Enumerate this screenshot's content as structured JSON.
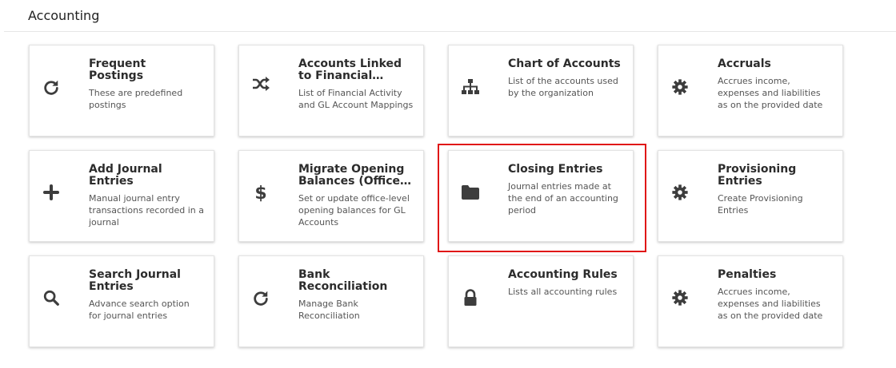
{
  "page": {
    "title": "Accounting"
  },
  "colors": {
    "icon": "#3d3d3d",
    "highlight": "#e01717"
  },
  "cards": [
    {
      "title": "Frequent Postings",
      "description": "These are predefined postings",
      "icon": "refresh-icon"
    },
    {
      "title": "Accounts Linked to Financial Activities",
      "description": "List of Financial Activity and GL Account Mappings",
      "icon": "shuffle-icon"
    },
    {
      "title": "Chart of Accounts",
      "description": "List of the accounts used by the organization",
      "icon": "sitemap-icon"
    },
    {
      "title": "Accruals",
      "description": "Accrues income, expenses and liabilities as on the provided date",
      "icon": "gear-icon"
    },
    {
      "title": "Add Journal Entries",
      "description": "Manual journal entry transactions recorded in a journal",
      "icon": "plus-icon"
    },
    {
      "title": "Migrate Opening Balances (Office-wise)",
      "description": "Set or update office-level opening balances for GL Accounts",
      "icon": "dollar-icon"
    },
    {
      "title": "Closing Entries",
      "description": "Journal entries made at the end of an accounting period",
      "icon": "folder-icon"
    },
    {
      "title": "Provisioning Entries",
      "description": "Create Provisioning Entries",
      "icon": "gear-icon"
    },
    {
      "title": "Search Journal Entries",
      "description": "Advance search option for journal entries",
      "icon": "search-icon"
    },
    {
      "title": "Bank Reconciliation",
      "description": "Manage Bank Reconciliation",
      "icon": "refresh-icon"
    },
    {
      "title": "Accounting Rules",
      "description": "Lists all accounting rules",
      "icon": "lock-icon"
    },
    {
      "title": "Penalties",
      "description": "Accrues income, expenses and liabilities as on the provided date",
      "icon": "gear-icon"
    }
  ]
}
